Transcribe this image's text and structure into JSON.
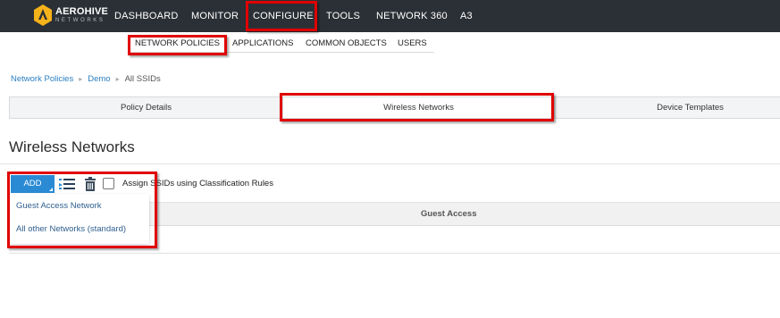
{
  "brand": {
    "name": "AEROHIVE",
    "sub": "NETWORKS"
  },
  "nav": {
    "items": [
      {
        "label": "DASHBOARD"
      },
      {
        "label": "MONITOR"
      },
      {
        "label": "CONFIGURE"
      },
      {
        "label": "TOOLS"
      },
      {
        "label": "NETWORK 360"
      },
      {
        "label": "A3"
      }
    ]
  },
  "subnav": {
    "items": [
      {
        "label": "NETWORK POLICIES"
      },
      {
        "label": "APPLICATIONS"
      },
      {
        "label": "COMMON OBJECTS"
      },
      {
        "label": "USERS"
      }
    ]
  },
  "breadcrumb": {
    "items": [
      "Network Policies",
      "Demo",
      "All SSIDs"
    ]
  },
  "tabs": [
    {
      "label": "Policy Details"
    },
    {
      "label": "Wireless Networks"
    },
    {
      "label": "Device Templates"
    }
  ],
  "page": {
    "title": "Wireless Networks"
  },
  "toolbar": {
    "add_label": "ADD",
    "assign_label": "Assign SSIDs using Classification Rules"
  },
  "table": {
    "columns": [
      "Guest Access"
    ]
  },
  "add_menu": {
    "items": [
      "Guest Access Network",
      "All other Networks (standard)"
    ]
  },
  "colors": {
    "topbar": "#2b3036",
    "accent": "#2a8ad4",
    "highlight": "#e00000",
    "link": "#2a7fc1"
  }
}
